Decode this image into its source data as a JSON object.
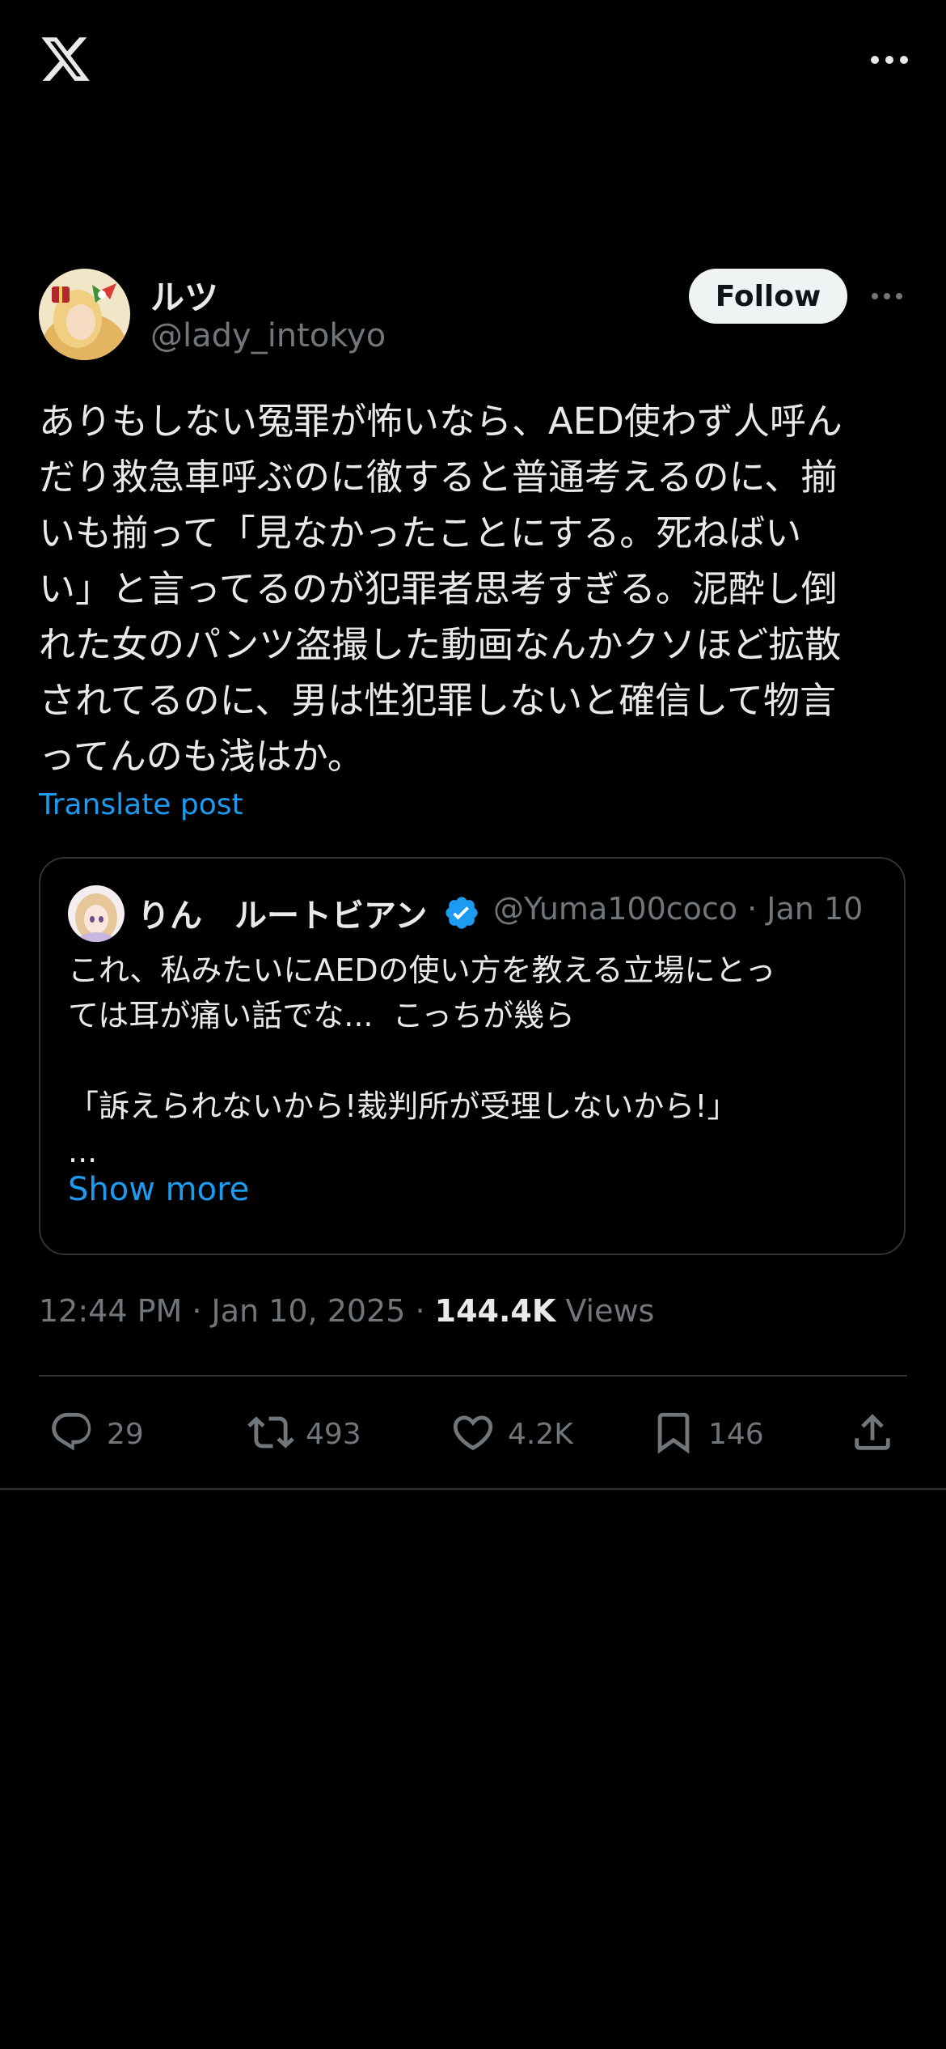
{
  "header": {
    "logo_icon": "x-logo-icon",
    "more_icon": "more-horizontal-icon"
  },
  "author": {
    "name": "ルツ",
    "handle": "@lady_intokyo",
    "follow_label": "Follow"
  },
  "tweet": {
    "text": "ありもしない冤罪が怖いなら、AED使わず人呼ん\nだり救急車呼ぶのに徹すると普通考えるのに、揃\nいも揃って「見なかったことにする。死ねばい\nい」と言ってるのが犯罪者思考すぎる。泥酔し倒\nれた女のパンツ盗撮した動画なんかクソほど拡散\nされてるのに、男は性犯罪しないと確信して物言\nってんのも浅はか。",
    "translate_label": "Translate post"
  },
  "quote": {
    "name": "りん　ルートビアン",
    "verified": true,
    "meta": "@Yuma100coco · Jan 10",
    "text": "これ、私みたいにAEDの使い方を教える立場にとっ\nては耳が痛い話でな...  こっちが幾ら\n\n「訴えられないから!裁判所が受理しないから!」\n...",
    "show_more_label": "Show more"
  },
  "timestamp": {
    "time": "12:44 PM · Jan 10, 2025 · ",
    "views_count": "144.4K",
    "views_label": " Views"
  },
  "actions": {
    "reply_count": "29",
    "repost_count": "493",
    "like_count": "4.2K",
    "bookmark_count": "146"
  },
  "colors": {
    "background": "#000000",
    "text": "#e7e9ea",
    "secondary": "#71767b",
    "accent": "#1d9bf0",
    "border": "#2f3336"
  }
}
